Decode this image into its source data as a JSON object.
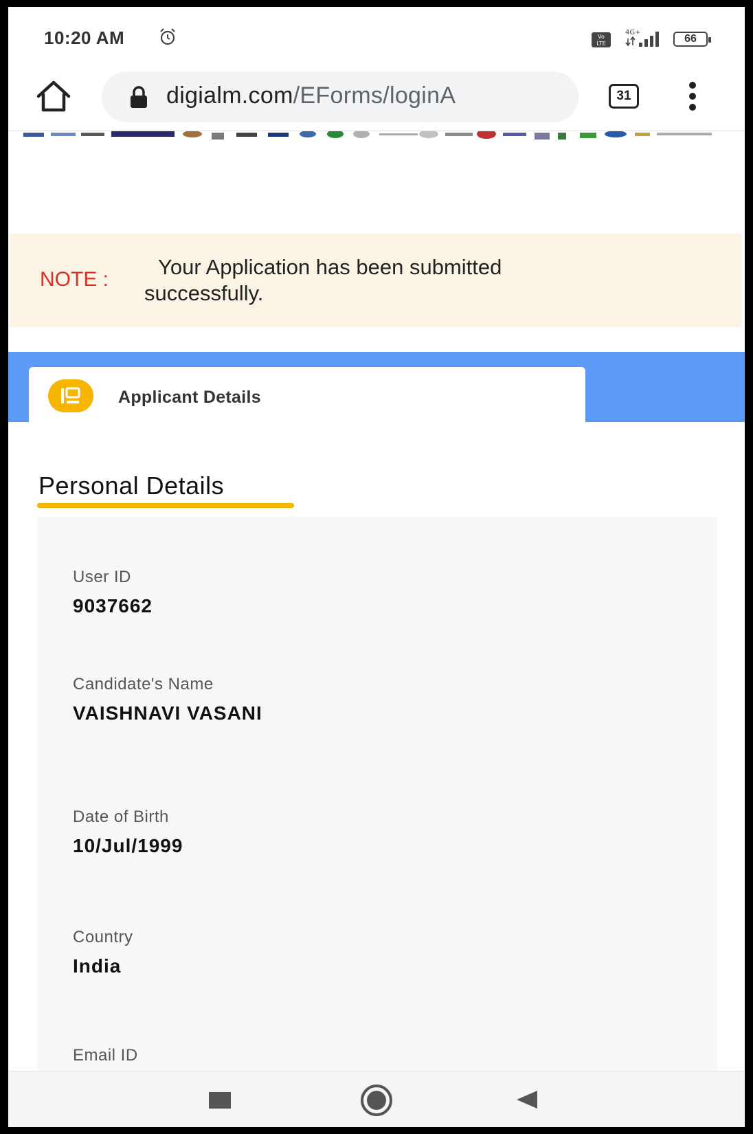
{
  "status_bar": {
    "time": "10:20 AM",
    "network": "4G+",
    "battery": "66",
    "icons": [
      "alarm-icon",
      "volte-icon",
      "signal-icon",
      "battery-icon"
    ]
  },
  "browser": {
    "url_host": "digialm.com",
    "url_path": "/EForms/loginA",
    "tab_count": "31",
    "icons": [
      "home-icon",
      "lock-icon",
      "tabs-icon",
      "menu-icon"
    ]
  },
  "note": {
    "label": "NOTE :",
    "message": "Your Application has been submitted successfully."
  },
  "applicant_tab": {
    "label": "Applicant Details",
    "icon": "id-card-icon"
  },
  "personal_details": {
    "title": "Personal Details",
    "fields": [
      {
        "label": "User ID",
        "value": "9037662"
      },
      {
        "label": "Candidate's Name",
        "value": "VAISHNAVI VASANI"
      },
      {
        "label": "Date of Birth",
        "value": "10/Jul/1999"
      },
      {
        "label": "Country",
        "value": "India"
      },
      {
        "label": "Email ID",
        "value": ""
      }
    ]
  },
  "colors": {
    "accent_blue": "#5b9af5",
    "accent_yellow": "#f5b800",
    "note_bg": "#fbf4e4",
    "note_label": "#d93025"
  },
  "nav_bar": {
    "icons": [
      "recent-apps-icon",
      "home-circle-icon",
      "back-icon"
    ]
  }
}
